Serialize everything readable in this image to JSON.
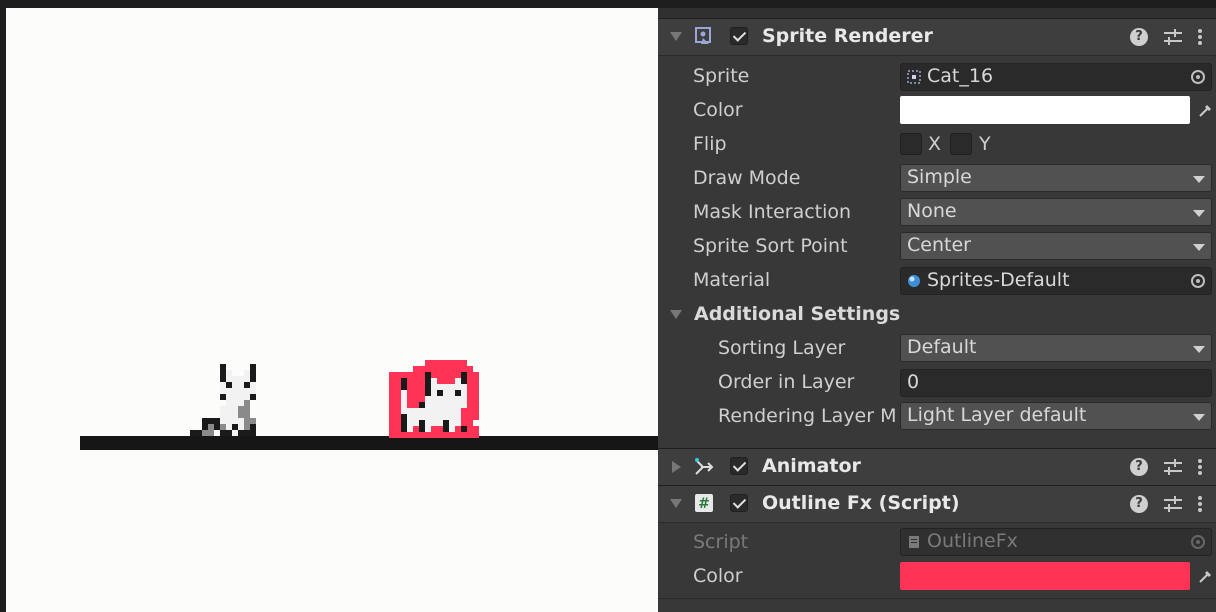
{
  "sprite_renderer": {
    "title": "Sprite Renderer",
    "enabled": true,
    "sprite": {
      "label": "Sprite",
      "value": "Cat_16"
    },
    "color": {
      "label": "Color",
      "hex": "#ffffff"
    },
    "flip": {
      "label": "Flip",
      "x_label": "X",
      "y_label": "Y",
      "x": false,
      "y": false
    },
    "draw_mode": {
      "label": "Draw Mode",
      "value": "Simple"
    },
    "mask_interaction": {
      "label": "Mask Interaction",
      "value": "None"
    },
    "sort_point": {
      "label": "Sprite Sort Point",
      "value": "Center"
    },
    "material": {
      "label": "Material",
      "value": "Sprites-Default"
    },
    "additional": {
      "label": "Additional Settings",
      "sorting_layer": {
        "label": "Sorting Layer",
        "value": "Default"
      },
      "order_in_layer": {
        "label": "Order in Layer",
        "value": "0"
      },
      "rendering_layer": {
        "label": "Rendering Layer M",
        "value": "Light Layer default"
      }
    }
  },
  "animator": {
    "title": "Animator",
    "enabled": true
  },
  "outline_fx": {
    "title": "Outline Fx (Script)",
    "enabled": true,
    "script": {
      "label": "Script",
      "value": "OutlineFx"
    },
    "color": {
      "label": "Color",
      "hex": "#ff3355"
    }
  },
  "icons": {
    "help": "help-icon",
    "preset": "preset-sliders-icon",
    "menu": "kebab-menu-icon",
    "sprite_renderer": "sprite-renderer-icon",
    "animator": "animator-icon",
    "script": "csharp-script-icon"
  },
  "colors": {
    "outline": "#ff3355",
    "scene_bg": "#fcfcfa",
    "ground": "#161616"
  }
}
